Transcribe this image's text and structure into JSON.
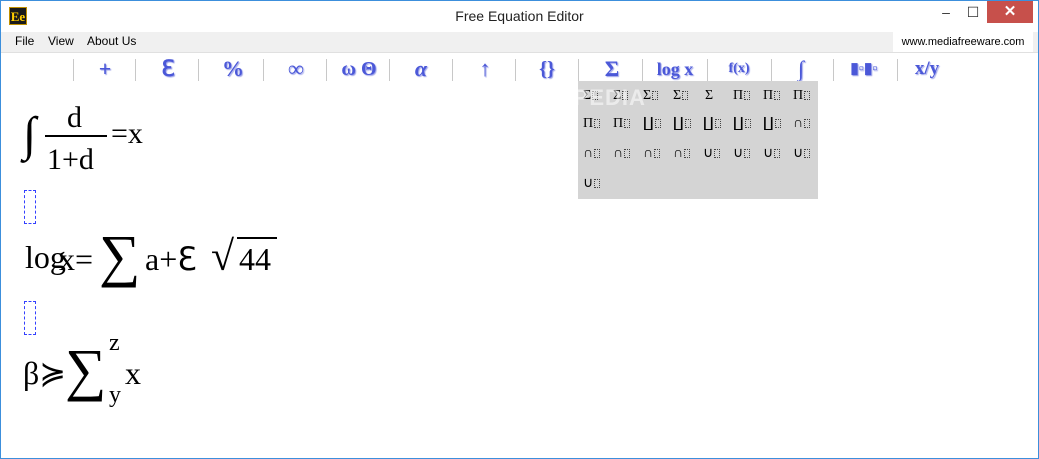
{
  "window": {
    "title": "Free Equation Editor",
    "icon_text": "Ee",
    "controls": {
      "minimize": "–",
      "maximize": "☐",
      "close": "✕"
    }
  },
  "menu": {
    "items": [
      "File",
      "View",
      "About Us"
    ],
    "website": "www.mediafreeware.com"
  },
  "toolbar": {
    "buttons": [
      "+",
      "ℇ",
      "%",
      "∞",
      "ω Θ",
      "α",
      "↑",
      "{}",
      "Σ",
      "log x",
      "f(x)",
      "∫",
      "▮▫▮▫",
      "x/y"
    ]
  },
  "watermark": "SOFTPEDIA",
  "popup": {
    "rows": [
      [
        "Σ",
        "Σ",
        "Σ",
        "Σ",
        "Σ",
        "Π",
        "Π",
        "Π"
      ],
      [
        "Π",
        "Π",
        "∐",
        "∐",
        "∐",
        "∐",
        "∐",
        "∩"
      ],
      [
        "∩",
        "∩",
        "∩",
        "∩",
        "∪",
        "∪",
        "∪",
        "∪"
      ],
      [
        "∪"
      ]
    ]
  },
  "equations": {
    "eq1": {
      "integral": "∫",
      "numerator": "d",
      "denominator": "1+d",
      "rhs": "=x"
    },
    "eq2": {
      "log": "log",
      "mid": "x=",
      "sigma": "∑",
      "terms": "a+ℇ",
      "radical": "√",
      "radicand": "44"
    },
    "eq3": {
      "lhs": "β≽",
      "sigma": "∑",
      "upper": "z",
      "lower": "y",
      "rhs": "x"
    }
  }
}
